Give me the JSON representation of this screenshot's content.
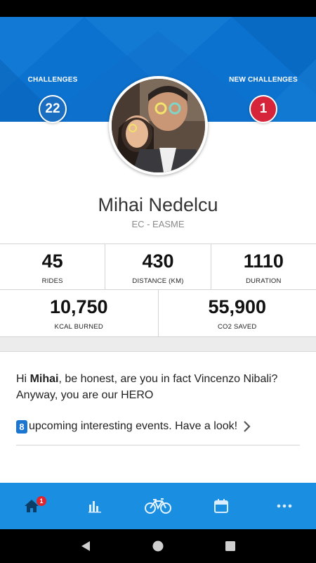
{
  "header": {
    "challenges_label": "CHALLENGES",
    "challenges_count": "22",
    "new_challenges_label": "NEW CHALLENGES",
    "new_challenges_count": "1"
  },
  "profile": {
    "name": "Mihai Nedelcu",
    "organization": "EC - EASME"
  },
  "stats": {
    "rides": {
      "value": "45",
      "label": "RIDES"
    },
    "distance": {
      "value": "430",
      "label": "DISTANCE (KM)"
    },
    "duration": {
      "value": "1110",
      "label": "DURATION"
    },
    "kcal": {
      "value": "10,750",
      "label": "KCAL BURNED"
    },
    "co2": {
      "value": "55,900",
      "label": "CO2 SAVED"
    }
  },
  "message": {
    "greeting": "Hi ",
    "user": "Mihai",
    "text": ", be honest, are you in fact Vincenzo Nibali? Anyway, you are our HERO"
  },
  "events": {
    "count": "8",
    "text": "upcoming interesting events. Have a look!"
  },
  "tabbar": {
    "home_badge": "1",
    "tabs": [
      "home-icon",
      "stats-icon",
      "bike-icon",
      "calendar-icon",
      "more-icon"
    ]
  },
  "colors": {
    "header_blue": "#0b72cf",
    "tabbar_blue": "#1a8fe2",
    "badge_red": "#d6243b",
    "badge_blue": "#1a6ec2"
  }
}
